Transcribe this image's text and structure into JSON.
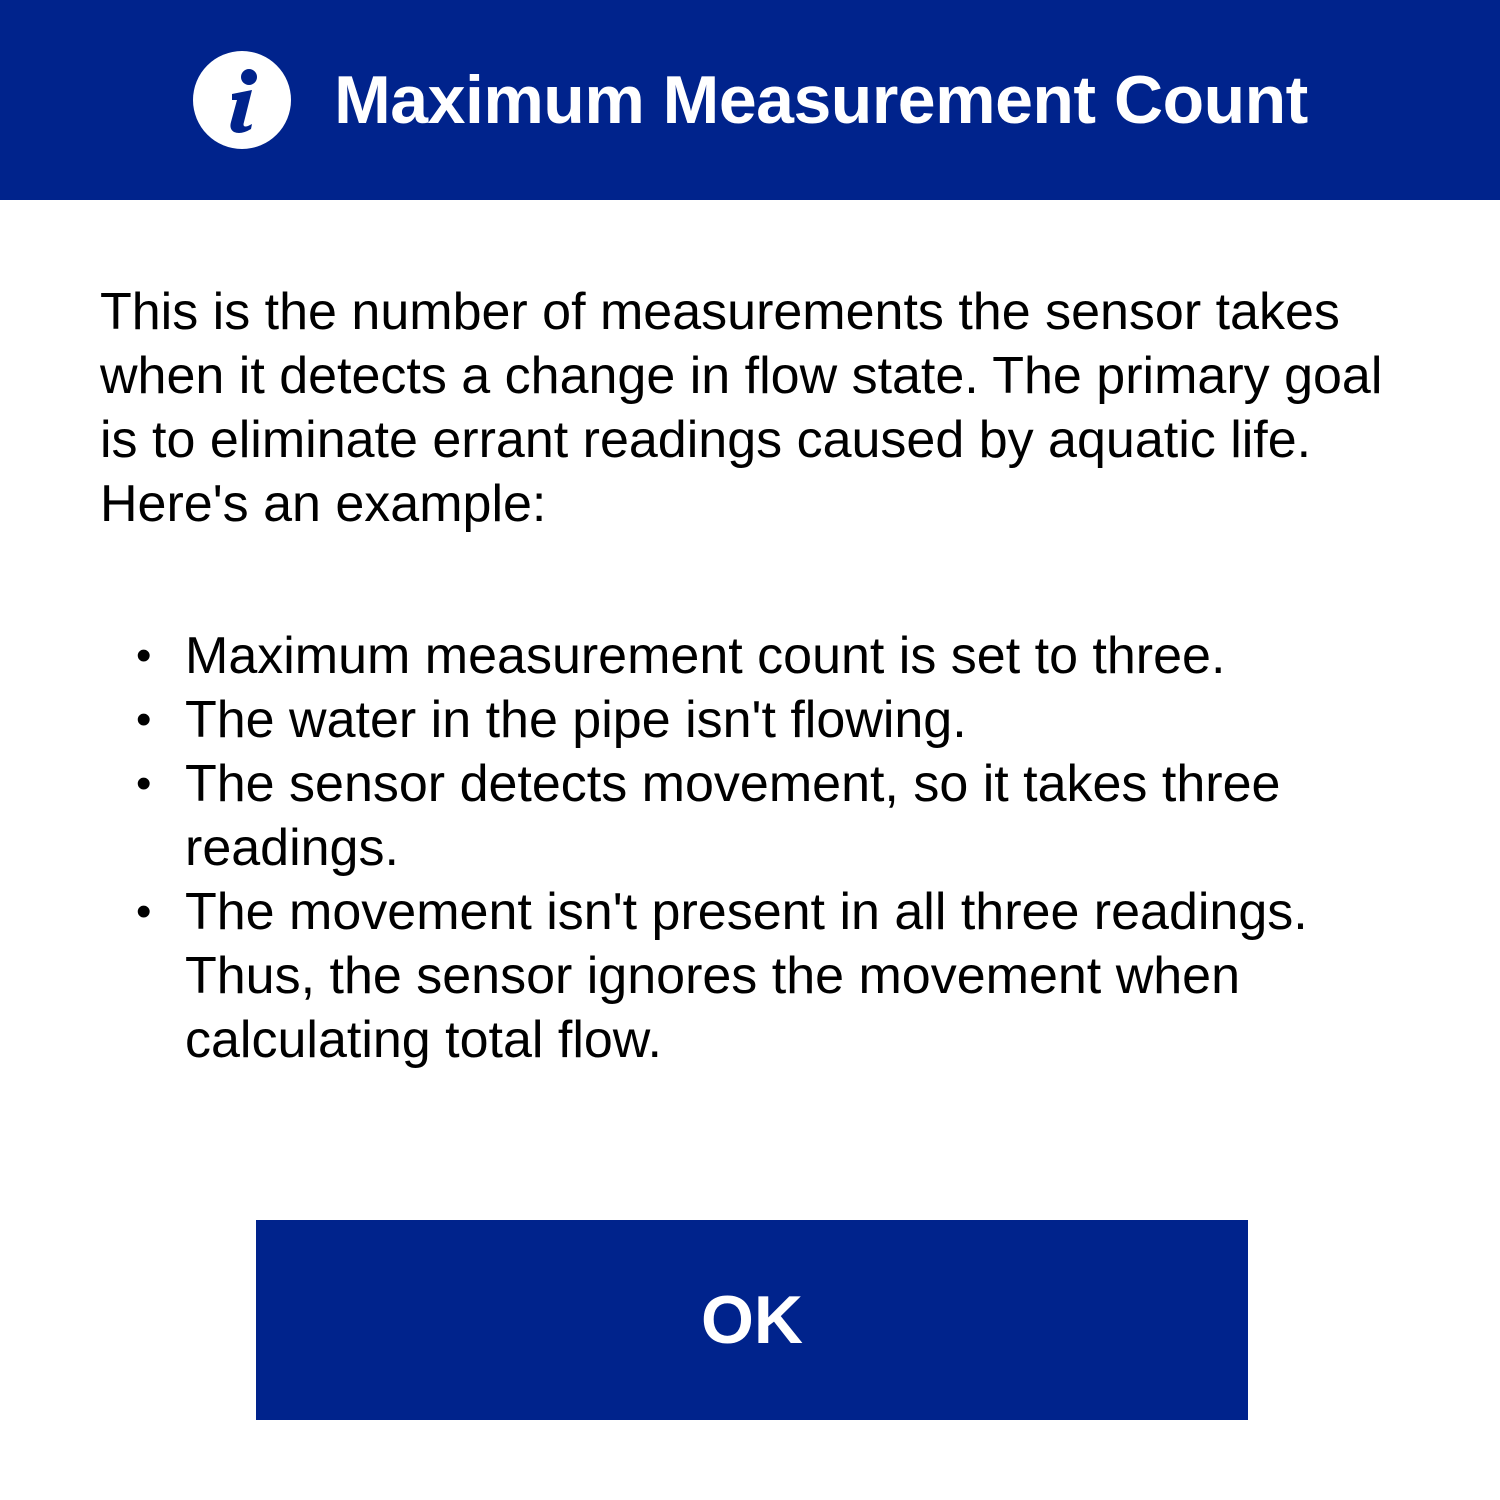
{
  "dialog": {
    "title": "Maximum Measurement Count",
    "icon": "info-icon",
    "intro": "This is the number of measurements the sensor takes when it detects a change in flow state. The primary goal is to eliminate errant readings caused by aquatic life. Here's an example:",
    "bullet_symbol": "•",
    "bullets": [
      "Maximum measurement count is set to three.",
      "The water in the pipe isn't flowing.",
      "The sensor detects movement, so it takes three readings.",
      "The movement isn't present in all three readings. Thus, the sensor ignores the movement when calculating total flow."
    ],
    "ok_label": "OK"
  },
  "colors": {
    "brand": "#00238c",
    "text": "#000000",
    "background": "#ffffff"
  }
}
